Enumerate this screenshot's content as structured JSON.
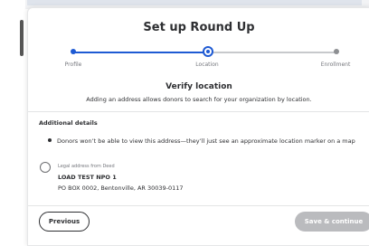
{
  "modal": {
    "title": "Set up Round Up"
  },
  "stepper": {
    "steps": [
      {
        "label": "Profile",
        "state": "complete"
      },
      {
        "label": "Location",
        "state": "current"
      },
      {
        "label": "Enrollment",
        "state": "upcoming"
      }
    ]
  },
  "verify": {
    "title": "Verify location",
    "subtitle": "Adding an address allows donors to search for your organization by location."
  },
  "additional": {
    "heading": "Additional details",
    "bullet": "Donors won’t be able to view this address—they’ll just see an approximate location marker on a map"
  },
  "address": {
    "label": "Legal address from Deed",
    "name": "LOAD TEST NPO 1",
    "line": "PO BOX 0002, Bentonville, AR 30039-0117",
    "selected": false
  },
  "footer": {
    "previous_label": "Previous",
    "save_label": "Save & continue"
  },
  "colors": {
    "accent": "#1e5ad3",
    "disabled": "#babbbe",
    "text": "#2e2f32"
  }
}
